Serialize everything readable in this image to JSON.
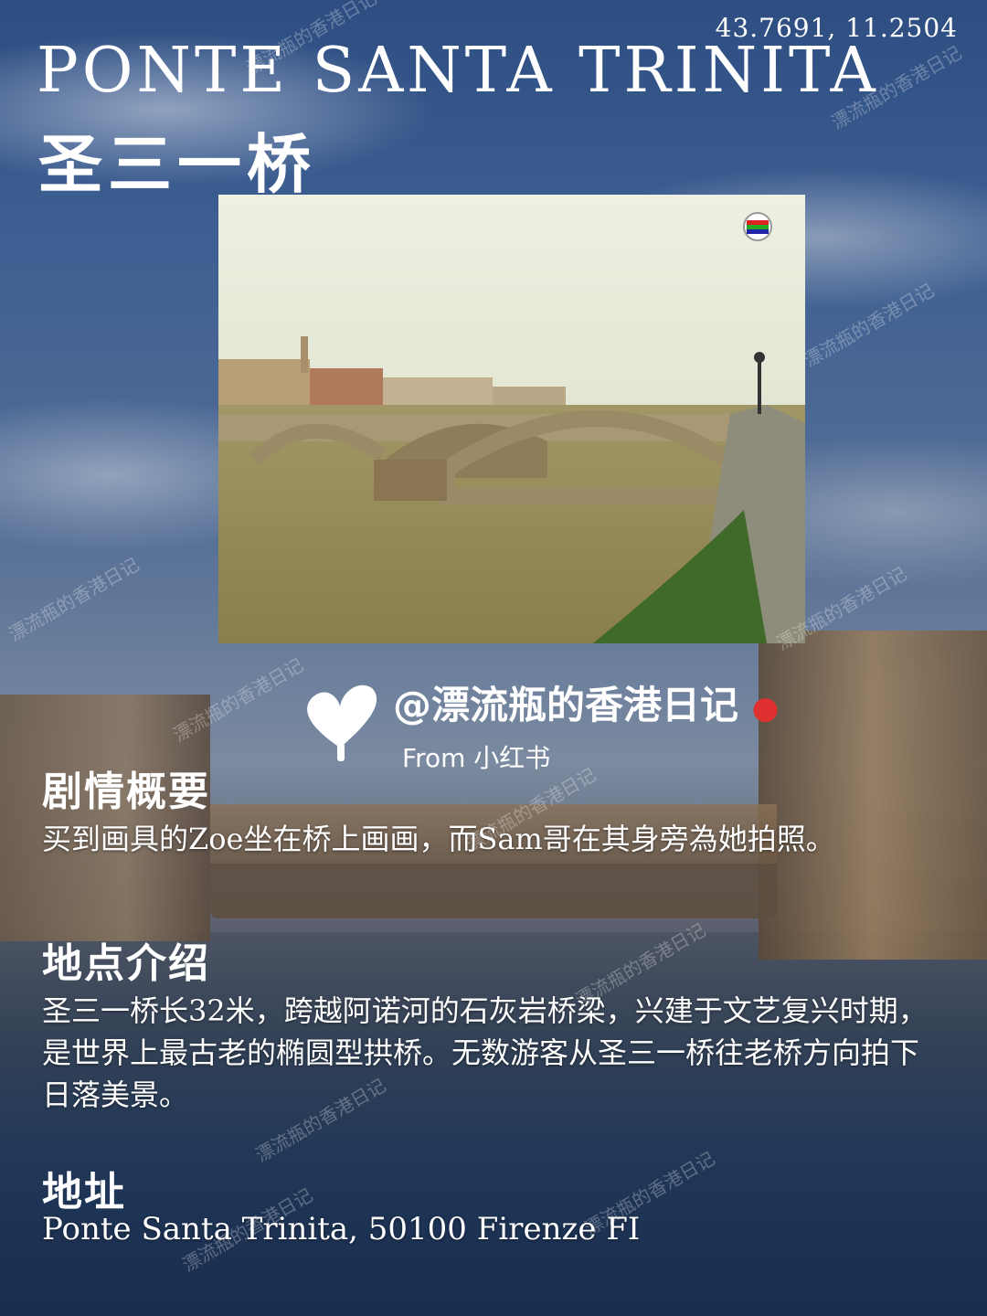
{
  "coords": "43.7691, 11.2504",
  "title_en": "Ponte Santa Trinita",
  "title_zh": "圣三一桥",
  "handle": "@漂流瓶的香港日记",
  "from": "From 小红书",
  "sections": [
    {
      "heading": "剧情概要",
      "body": "买到画具的Zoe坐在桥上画画，而Sam哥在其身旁為她拍照。"
    },
    {
      "heading": "地点介绍",
      "body": "圣三一桥长32米，跨越阿诺河的石灰岩桥梁，兴建于文艺复兴时期，是世界上最古老的椭圆型拱桥。无数游客从圣三一桥往老桥方向拍下日落美景。"
    },
    {
      "heading": "地址",
      "body": "Ponte Santa Trinita, 50100 Firenze FI"
    }
  ],
  "watermark": "漂流瓶的香港日记",
  "icons": [
    "heart-sprout-icon",
    "boxing-glove-icon",
    "tvb-logo-icon"
  ]
}
